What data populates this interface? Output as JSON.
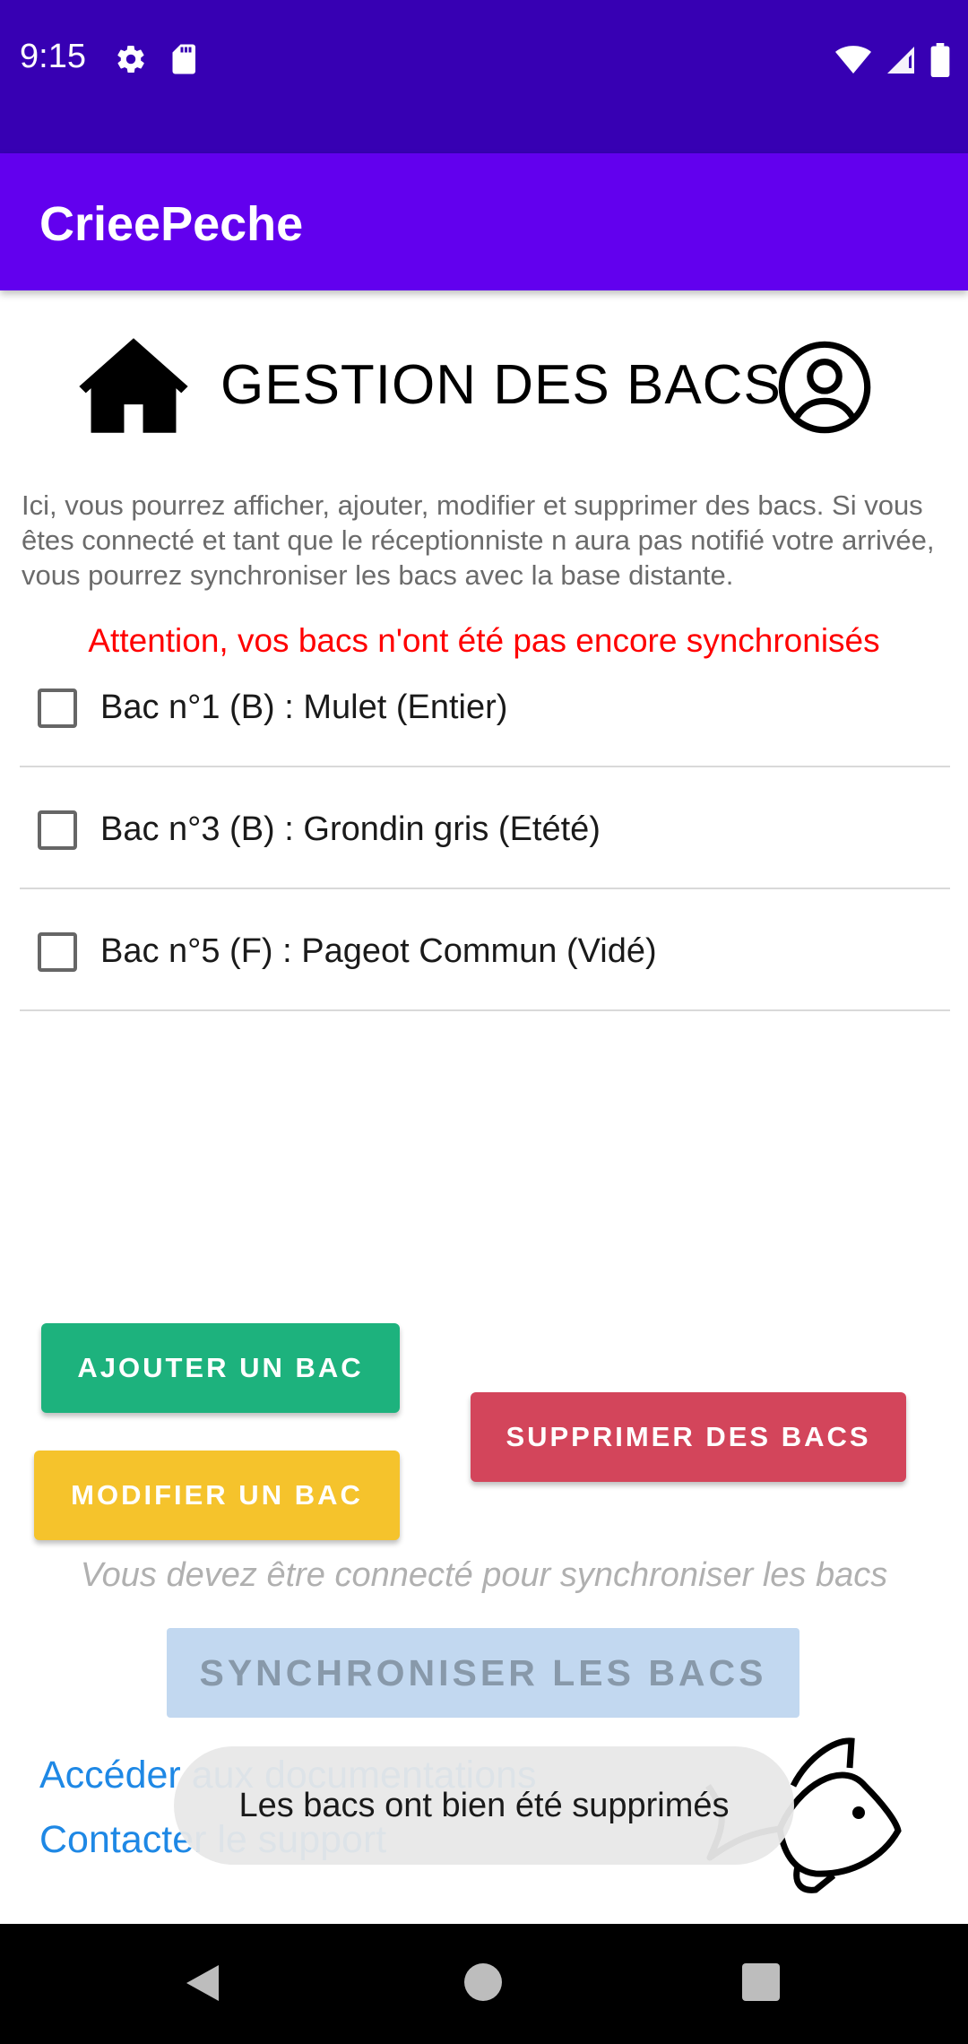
{
  "status_bar": {
    "time": "9:15",
    "icons_left": [
      "gear-icon",
      "sd-card-icon"
    ],
    "icons_right": [
      "wifi-icon",
      "cellular-signal-icon",
      "battery-icon"
    ]
  },
  "app_bar": {
    "title": "CrieePeche"
  },
  "header": {
    "title": "GESTION DES BACS",
    "left_icon": "home-icon",
    "right_icon": "account-icon"
  },
  "intro": "Ici, vous pourrez afficher, ajouter, modifier et supprimer des bacs. Si vous êtes connecté et tant que le réceptionniste n aura pas notifié votre arrivée, vous pourrez synchroniser les bacs avec la base distante.",
  "warning": "Attention, vos bacs n'ont été pas encore synchronisés",
  "bacs": [
    {
      "label": "Bac n°1 (B) : Mulet (Entier)",
      "checked": false
    },
    {
      "label": "Bac n°3 (B) : Grondin gris (Etété)",
      "checked": false
    },
    {
      "label": "Bac n°5 (F) : Pageot Commun (Vidé)",
      "checked": false
    }
  ],
  "buttons": {
    "add": "AJOUTER UN BAC",
    "edit": "MODIFIER UN BAC",
    "delete": "SUPPRIMER DES BACS",
    "sync": "SYNCHRONISER LES BACS"
  },
  "sync_note": "Vous devez être connecté pour synchroniser les bacs",
  "links": {
    "docs": "Accéder aux documentations",
    "support": "Contacter le support"
  },
  "toast": "Les bacs ont bien été supprimés",
  "colors": {
    "status_bar": "#3700b3",
    "app_bar": "#6200ee",
    "add": "#1db27d",
    "edit": "#f5c32c",
    "delete": "#d3455b",
    "sync": "#c2d8f0",
    "warning": "#ff0000",
    "link": "#1e88e5"
  }
}
